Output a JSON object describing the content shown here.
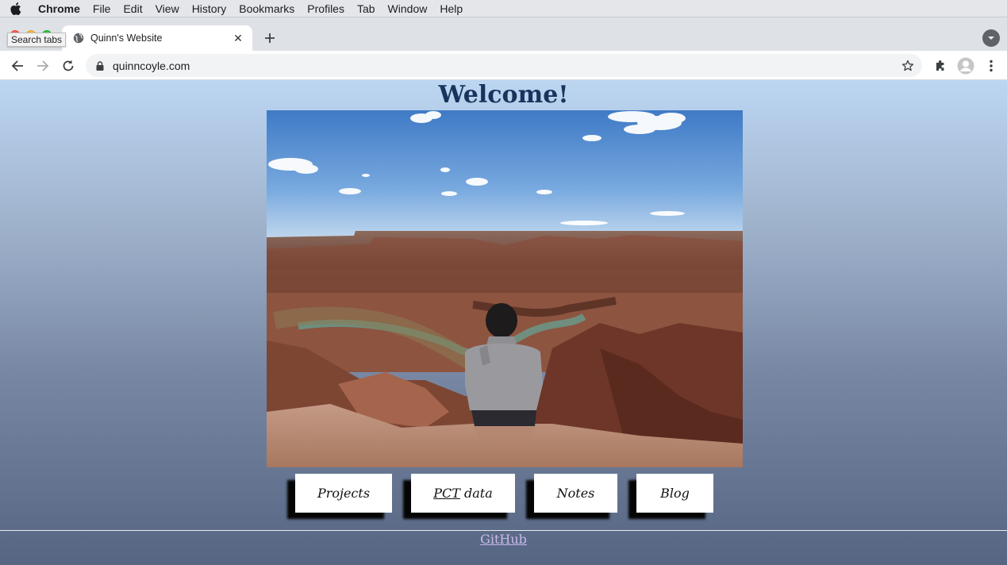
{
  "menubar": {
    "app_name": "Chrome",
    "items": [
      "File",
      "Edit",
      "View",
      "History",
      "Bookmarks",
      "Profiles",
      "Tab",
      "Window",
      "Help"
    ]
  },
  "tooltip": {
    "text": "Search tabs"
  },
  "tab": {
    "title": "Quinn's Website",
    "close_symbol": "✕"
  },
  "omnibox": {
    "url": "quinncoyle.com"
  },
  "page": {
    "heading": "Welcome!",
    "nav": [
      {
        "label": "Projects"
      },
      {
        "label_underlined": "PCT",
        "label_rest": " data"
      },
      {
        "label": "Notes"
      },
      {
        "label": "Blog"
      }
    ],
    "footer_link": "GitHub"
  },
  "colors": {
    "heading": "#17345c",
    "footer_link": "#c9b8ea",
    "button_bg": "#ffffff",
    "button_shadow": "#050505"
  },
  "icons": {
    "menubar": "apple-icon",
    "tab": "globe-icon",
    "toolbar": [
      "back-arrow-icon",
      "forward-arrow-icon",
      "reload-icon",
      "lock-icon",
      "star-icon",
      "extensions-icon",
      "profile-icon",
      "menu-dots-icon"
    ]
  }
}
